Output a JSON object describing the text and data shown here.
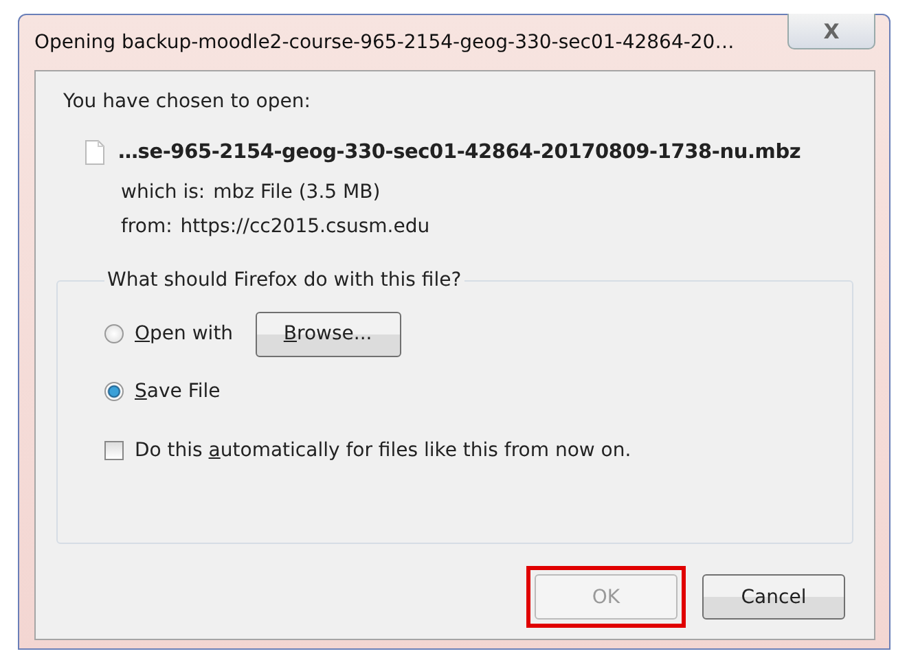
{
  "window": {
    "title": "Opening backup-moodle2-course-965-2154-geog-330-sec01-42864-20…",
    "close": "X"
  },
  "intro": "You have chosen to open:",
  "file": {
    "name": "…se-965-2154-geog-330-sec01-42864-20170809-1738-nu.mbz",
    "type_label": "which is:",
    "type": "mbz File (3.5 MB)",
    "from_label": "from:",
    "from": "https://cc2015.csusm.edu"
  },
  "action_group": {
    "legend": "What should Firefox do with this file?",
    "options": [
      {
        "label_parts": [
          {
            "text": "O",
            "underlined": true
          },
          {
            "text": "pen with",
            "underlined": false
          }
        ],
        "selected": false,
        "button": {
          "label_parts": [
            {
              "text": "B",
              "underlined": true
            },
            {
              "text": "rowse...",
              "underlined": false
            }
          ]
        }
      },
      {
        "label_parts": [
          {
            "text": "S",
            "underlined": true
          },
          {
            "text": "ave File",
            "underlined": false
          }
        ],
        "selected": true
      }
    ],
    "remember": {
      "label_parts": [
        {
          "text": "Do this ",
          "underlined": false
        },
        {
          "text": "a",
          "underlined": true
        },
        {
          "text": "utomatically for files like this from now on.",
          "underlined": false
        }
      ],
      "checked": false
    }
  },
  "buttons": [
    {
      "label": "OK",
      "disabled": true,
      "highlighted": true
    },
    {
      "label": "Cancel",
      "disabled": false,
      "highlighted": false
    }
  ]
}
